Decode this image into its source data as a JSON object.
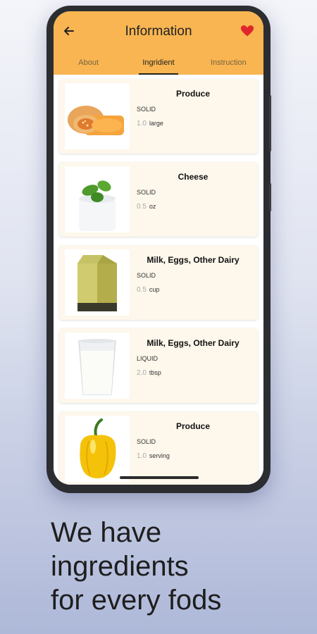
{
  "header": {
    "title": "Information",
    "back_icon": "arrow-left-icon",
    "favorite_icon": "heart-icon",
    "favorite_color": "#e0262b",
    "background": "#f8b551"
  },
  "tabs": [
    {
      "label": "About",
      "active": false
    },
    {
      "label": "Ingridient",
      "active": true
    },
    {
      "label": "Instruction",
      "active": false
    }
  ],
  "ingredients": [
    {
      "category": "Produce",
      "state": "SOLID",
      "amount": "1.0",
      "unit": "large",
      "image": "butternut-squash"
    },
    {
      "category": "Cheese",
      "state": "SOLID",
      "amount": "0.5",
      "unit": "oz",
      "image": "cheese-with-basil"
    },
    {
      "category": "Milk, Eggs, Other Dairy",
      "state": "SOLID",
      "amount": "0.5",
      "unit": "cup",
      "image": "milk-carton"
    },
    {
      "category": "Milk, Eggs, Other Dairy",
      "state": "LIQUID",
      "amount": "2.0",
      "unit": "tbsp",
      "image": "glass-of-milk"
    },
    {
      "category": "Produce",
      "state": "SOLID",
      "amount": "1.0",
      "unit": "serving",
      "image": "yellow-bell-pepper"
    }
  ],
  "tagline": [
    "We have",
    "ingredients",
    "for every fods"
  ]
}
